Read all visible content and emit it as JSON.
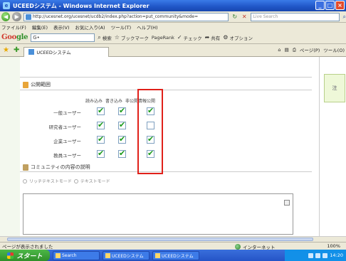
{
  "window": {
    "title": "UCEEDシステム - Windows Internet Explorer",
    "controls": [
      "_",
      "□",
      "×"
    ]
  },
  "address_bar": {
    "url": "http://ucesnet.org/ucesnet/ucdb2/index.php?action=put_community&mode=",
    "search_placeholder": "Live Search"
  },
  "menu": [
    "ファイル(F)",
    "編集(E)",
    "表示(V)",
    "お気に入り(A)",
    "ツール(T)",
    "ヘルプ(H)"
  ],
  "google_bar": {
    "logo_g": "Goo",
    "logo_rest": "gle",
    "search_value": "G•",
    "tools": [
      "検索",
      "ブックマーク",
      "PageRank",
      "チェック",
      "共有",
      "オプション"
    ]
  },
  "tab": {
    "label": "UCEEDシステム",
    "tools": [
      "ページ(P)",
      "ツール(O)"
    ]
  },
  "page": {
    "section_title": "公開範囲",
    "col_headers": [
      "読み込み",
      "書き込み",
      "非公開",
      "情報公開"
    ],
    "rows": [
      {
        "label": "一般ユーザー",
        "checks": [
          true,
          true,
          true
        ]
      },
      {
        "label": "研究者ユーザー",
        "checks": [
          true,
          true,
          false
        ]
      },
      {
        "label": "企業ユーザー",
        "checks": [
          true,
          true,
          true
        ]
      },
      {
        "label": "教員ユーザー",
        "checks": [
          true,
          true,
          true
        ]
      }
    ],
    "community_title": "コミュニティの内容の説明",
    "mode_rich": "リッチテキストモード",
    "mode_text": "テキストモード",
    "right_tab": "注"
  },
  "status": {
    "text": "ページが表示されました",
    "zone": "インターネット",
    "zoom": "100%"
  },
  "taskbar": {
    "start": "スタート",
    "items": [
      "Search",
      "UCEEDシステム",
      "UCEEDシステム"
    ],
    "time": "14:20"
  },
  "colors": {
    "highlight": "#e0201a",
    "check": "#1a9a1a"
  }
}
